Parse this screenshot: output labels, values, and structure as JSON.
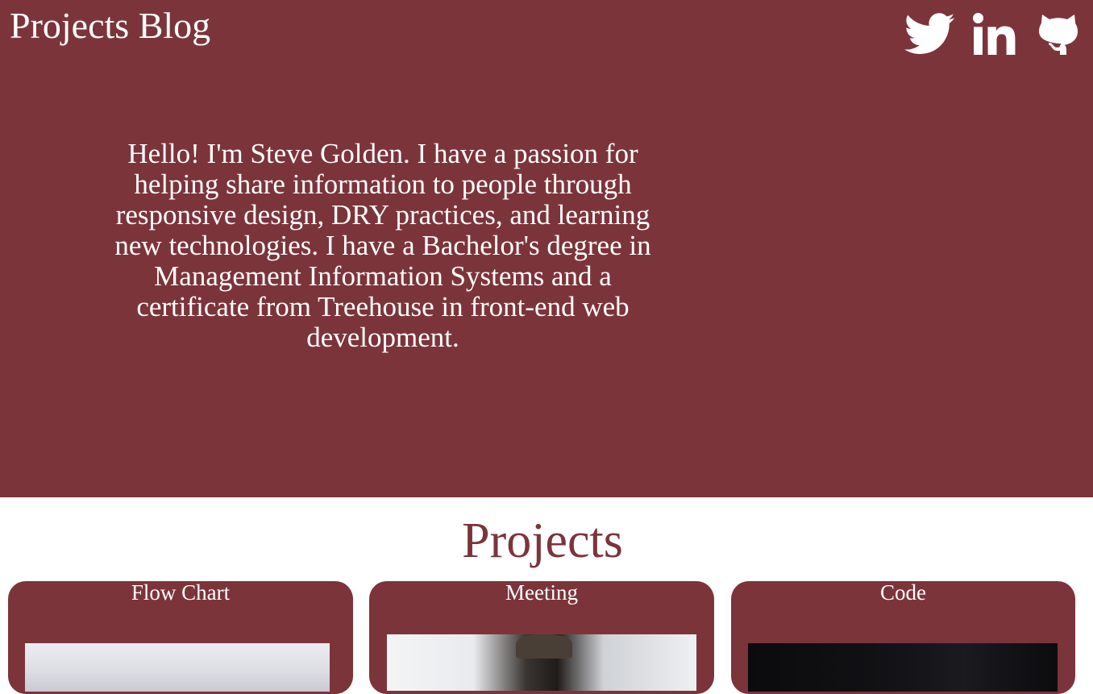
{
  "header": {
    "title": "Projects Blog",
    "social": [
      {
        "name": "twitter-icon",
        "label": "Twitter"
      },
      {
        "name": "linkedin-icon",
        "label": "LinkedIn"
      },
      {
        "name": "github-icon",
        "label": "GitHub"
      }
    ]
  },
  "bio": {
    "text": "Hello! I'm Steve Golden. I have a passion for helping share information to people through responsive design, DRY practices, and learning new technologies. I have a Bachelor's degree in Management Information Systems and a certificate from Treehouse in front-end web development."
  },
  "projects": {
    "heading": "Projects",
    "cards": [
      {
        "title": "Flow Chart"
      },
      {
        "title": "Meeting"
      },
      {
        "title": "Code"
      }
    ]
  },
  "colors": {
    "brand": "#7c343b",
    "text_on_brand": "#ffffff",
    "page_background": "#ffffff"
  }
}
